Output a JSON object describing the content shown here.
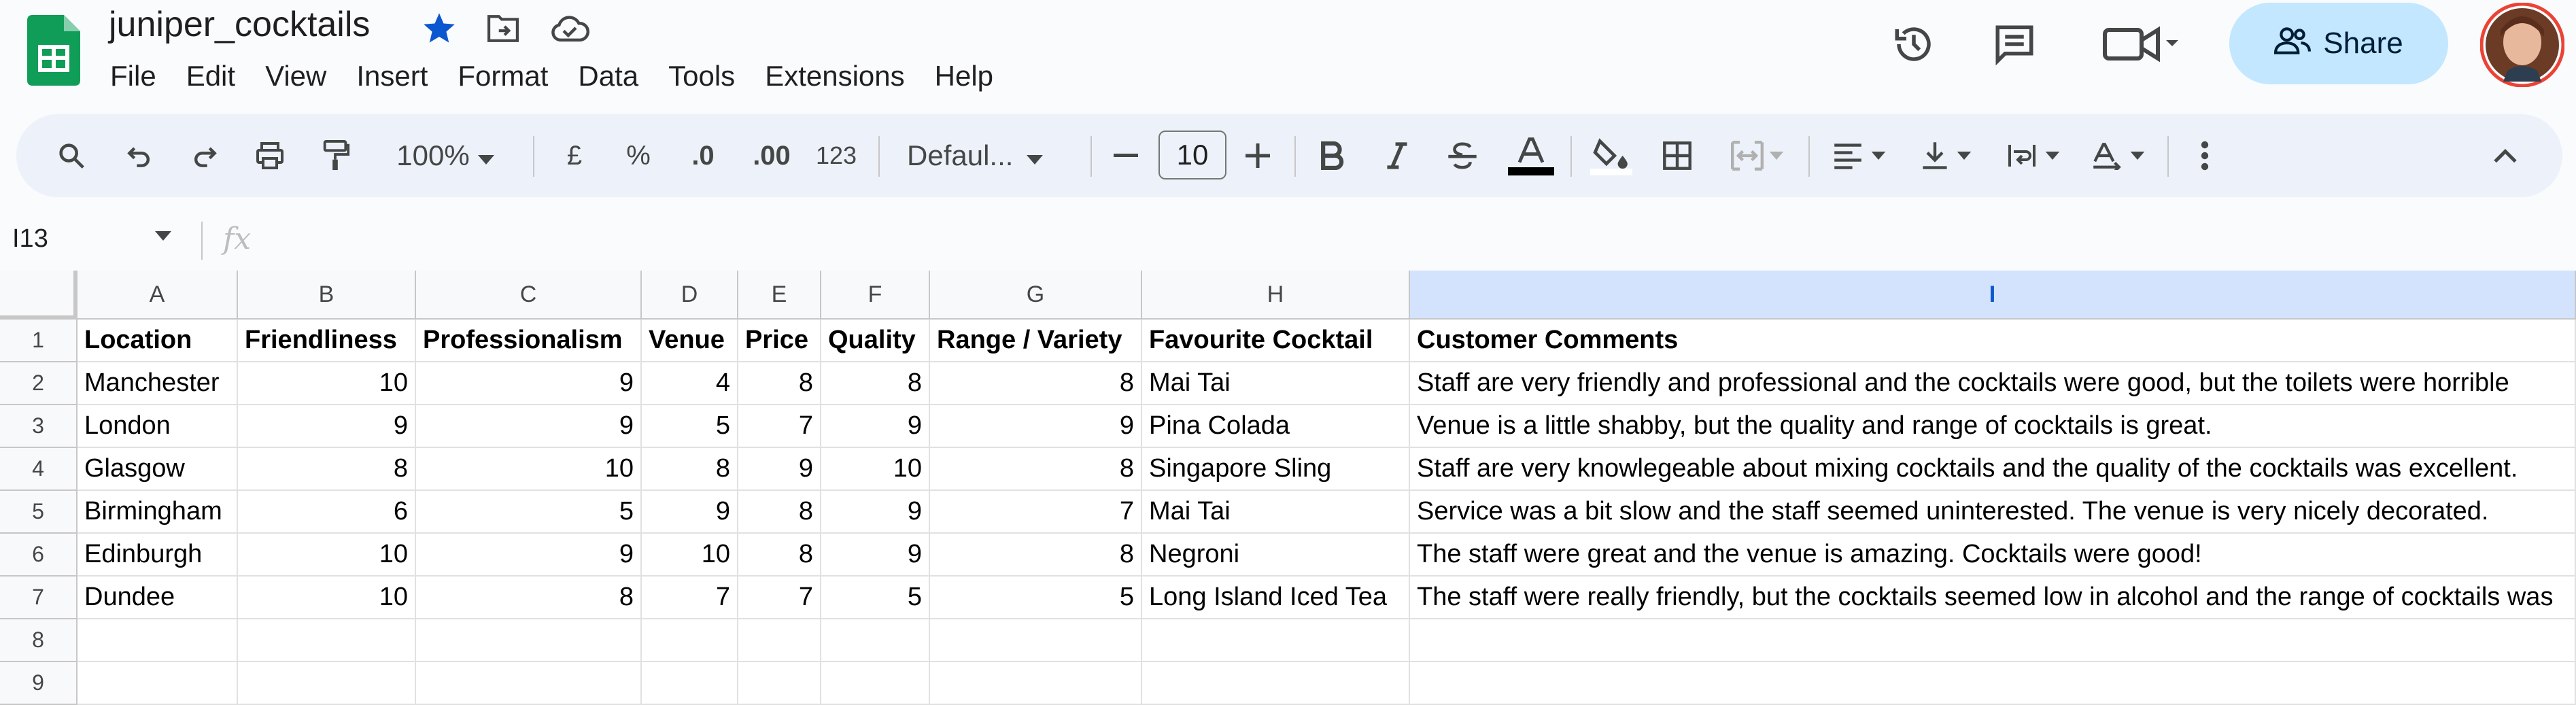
{
  "doc_title": "juniper_cocktails",
  "menu": [
    "File",
    "Edit",
    "View",
    "Insert",
    "Format",
    "Data",
    "Tools",
    "Extensions",
    "Help"
  ],
  "share_label": "Share",
  "toolbar": {
    "zoom": "100%",
    "currency": "£",
    "percent": "%",
    "dec_decrease": ".0",
    "dec_increase": ".00",
    "number_format": "123",
    "font": "Defaul...",
    "font_size": "10"
  },
  "name_box": "I13",
  "fx": "fx",
  "columns": [
    "A",
    "B",
    "C",
    "D",
    "E",
    "F",
    "G",
    "H",
    "I"
  ],
  "selected_column": "I",
  "rows": [
    "1",
    "2",
    "3",
    "4",
    "5",
    "6",
    "7",
    "8",
    "9"
  ],
  "sheet": [
    [
      "Location",
      "Friendliness",
      "Professionalism",
      "Venue",
      "Price",
      "Quality",
      "Range / Variety",
      "Favourite Cocktail",
      "Customer Comments"
    ],
    [
      "Manchester",
      "10",
      "9",
      "4",
      "8",
      "8",
      "8",
      "Mai Tai",
      "Staff are very friendly and professional and the cocktails were good, but the toilets were horrible"
    ],
    [
      "London",
      "9",
      "9",
      "5",
      "7",
      "9",
      "9",
      "Pina Colada",
      "Venue is a little shabby, but the quality and range of cocktails is great."
    ],
    [
      "Glasgow",
      "8",
      "10",
      "8",
      "9",
      "10",
      "8",
      "Singapore Sling",
      "Staff are very knowlegeable about mixing cocktails and the quality of the cocktails was excellent."
    ],
    [
      "Birmingham",
      "6",
      "5",
      "9",
      "8",
      "9",
      "7",
      "Mai Tai",
      "Service was a bit slow and the staff seemed uninterested.  The venue is very nicely decorated."
    ],
    [
      "Edinburgh",
      "10",
      "9",
      "10",
      "8",
      "9",
      "8",
      "Negroni",
      "The staff were great and the venue is amazing.  Cocktails were good!"
    ],
    [
      "Dundee",
      "10",
      "8",
      "7",
      "7",
      "5",
      "5",
      "Long Island Iced Tea",
      "The staff were really friendly, but the cocktails seemed low in alcohol and the range of cocktails was"
    ]
  ],
  "colors": {
    "accent": "#0b57d0",
    "share_bg": "#c2e7ff",
    "toolbar_bg": "#edf2fa",
    "selected_col_bg": "#d3e3fd"
  }
}
